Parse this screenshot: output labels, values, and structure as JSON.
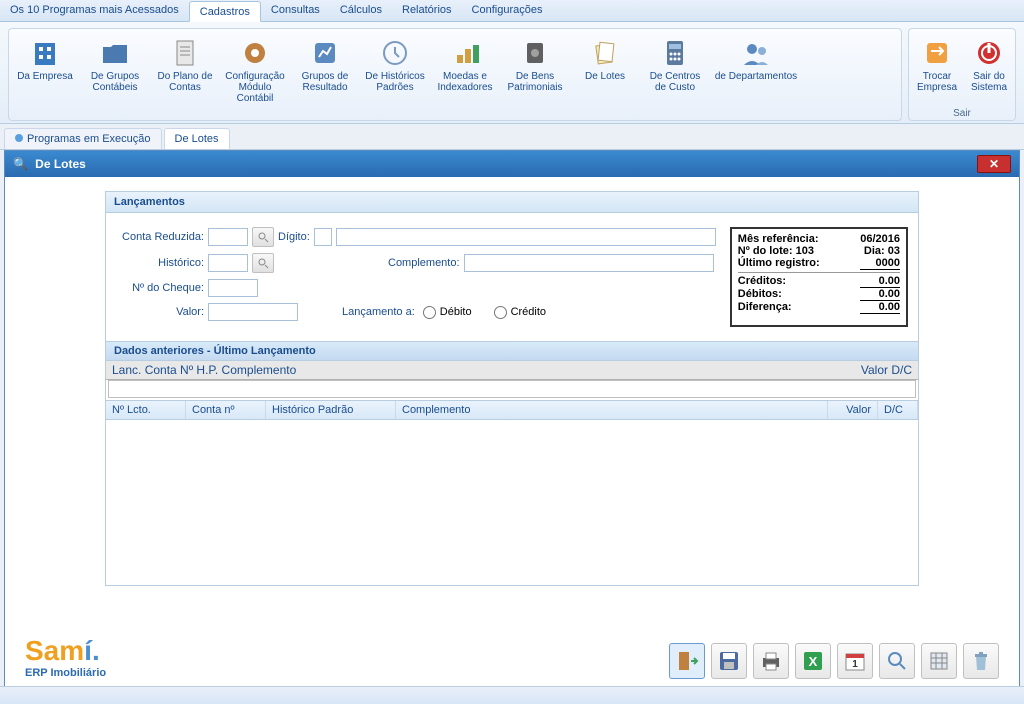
{
  "menu": {
    "items": [
      "Os 10 Programas mais Acessados",
      "Cadastros",
      "Consultas",
      "Cálculos",
      "Relatórios",
      "Configurações"
    ],
    "active_index": 1
  },
  "ribbon": {
    "main": [
      {
        "label": "Da Empresa"
      },
      {
        "label": "De Grupos Contábeis"
      },
      {
        "label": "Do Plano de Contas"
      },
      {
        "label": "Configuração Módulo Contábil"
      },
      {
        "label": "Grupos de Resultado"
      },
      {
        "label": "De Históricos Padrões"
      },
      {
        "label": "Moedas e Indexadores"
      },
      {
        "label": "De Bens Patrimoniais"
      },
      {
        "label": "De Lotes"
      },
      {
        "label": "De Centros de Custo"
      },
      {
        "label": "de Departamentos"
      }
    ],
    "exit": {
      "group_label": "Sair",
      "items": [
        {
          "label": "Trocar Empresa"
        },
        {
          "label": "Sair do Sistema"
        }
      ]
    }
  },
  "tabs": {
    "items": [
      "Programas em Execução",
      "De Lotes"
    ],
    "active_index": 1
  },
  "window": {
    "title": "De Lotes"
  },
  "panel": {
    "title": "Lançamentos"
  },
  "form": {
    "conta_reduzida": "Conta Reduzida:",
    "digito": "Dígito:",
    "historico": "Histórico:",
    "complemento": "Complemento:",
    "n_cheque": "Nº do Cheque:",
    "valor": "Valor:",
    "lancamento_a": "Lançamento a:",
    "debito": "Débito",
    "credito": "Crédito"
  },
  "info": {
    "mes_ref_label": "Mês referência:",
    "mes_ref_val": "06/2016",
    "n_lote_label": "Nº do lote:",
    "n_lote_val": "103",
    "dia_label": "Dia:",
    "dia_val": "03",
    "ultimo_reg_label": "Último registro:",
    "ultimo_reg_val": "0000",
    "creditos_label": "Créditos:",
    "creditos_val": "0.00",
    "debitos_label": "Débitos:",
    "debitos_val": "0.00",
    "diferenca_label": "Diferença:",
    "diferenca_val": "0.00"
  },
  "subpanel": {
    "title": "Dados anteriores - Último Lançamento",
    "mono_cols_left": "Lanc. Conta Nº  H.P. Complemento",
    "mono_cols_right": "Valor D/C"
  },
  "grid": {
    "cols": [
      "Nº Lcto.",
      "Conta nº",
      "Histórico Padrão",
      "Complemento",
      "Valor",
      "D/C"
    ]
  },
  "logo": {
    "line1a": "Sam",
    "line1b": "í",
    "line2": "ERP Imobiliário"
  },
  "toolbar_icons": [
    "door-exit-icon",
    "save-icon",
    "print-icon",
    "excel-icon",
    "calendar-icon",
    "search-icon",
    "grid-icon",
    "trash-icon"
  ]
}
